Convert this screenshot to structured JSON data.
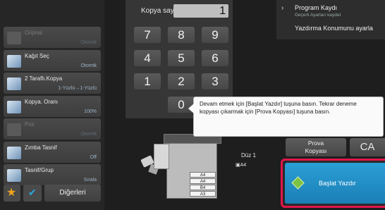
{
  "settings": [
    {
      "label": "Orijinal",
      "value": "Otomtk",
      "dim": true
    },
    {
      "label": "Kağıt Seç",
      "value": "Otomtk",
      "dim": false
    },
    {
      "label": "2 Taraflı.Kopya",
      "value": "1-Yüzlü→1-Yüzlü",
      "dim": false
    },
    {
      "label": "Kopya. Oranı",
      "value": "100%",
      "dim": false
    },
    {
      "label": "Poz",
      "value": "Otomtk",
      "dim": true
    },
    {
      "label": "Zımba Tasnif",
      "value": "Off",
      "dim": false
    },
    {
      "label": "Tasnif/Grup",
      "value": "Sırala",
      "dim": false
    }
  ],
  "bottom_bar": {
    "others_label": "Diğerleri"
  },
  "copies": {
    "label": "Kopya sayısı",
    "value": "1"
  },
  "keypad": {
    "keys": [
      "7",
      "8",
      "9",
      "4",
      "5",
      "6",
      "1",
      "2",
      "3",
      "0"
    ]
  },
  "menu": {
    "program_title": "Program Kaydı",
    "program_sub": "Geçerli Ayarları kaydet",
    "print_location": "Yazdırma Konumunu ayarla"
  },
  "tooltip": {
    "text": "Devam etmek için [Başlat Yazdır] tuşuna basın. Tekrar deneme kopyası çıkarmak için [Prova Kopyası] tuşuna basın."
  },
  "buttons": {
    "proof": "Prova Kopyası",
    "ca": "CA",
    "start": "Başlat Yazdır"
  },
  "preview": {
    "duplex": "Düz 1",
    "paper_size": "A4",
    "trays": [
      "A4",
      "A4",
      "B4",
      "A3"
    ]
  },
  "colors": {
    "accent": "#1f8ec8",
    "highlight": "#e0164a"
  }
}
